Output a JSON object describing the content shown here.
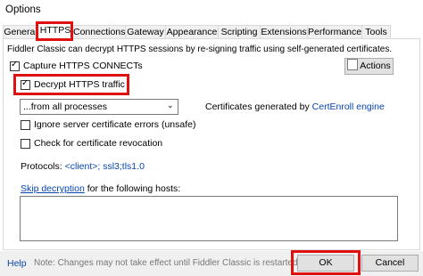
{
  "window": {
    "title": "Options"
  },
  "tabs": [
    {
      "label": "General"
    },
    {
      "label": "HTTPS"
    },
    {
      "label": "Connections"
    },
    {
      "label": "Gateway"
    },
    {
      "label": "Appearance"
    },
    {
      "label": "Scripting"
    },
    {
      "label": "Extensions"
    },
    {
      "label": "Performance"
    },
    {
      "label": "Tools"
    }
  ],
  "https": {
    "description": "Fiddler Classic can decrypt HTTPS sessions by re-signing traffic using self-generated certificates.",
    "actions_label": "Actions",
    "capture_label": "Capture HTTPS CONNECTs",
    "decrypt_label": "Decrypt HTTPS traffic",
    "process_select": "...from all processes",
    "cert_generated_text": "Certificates generated by ",
    "cert_engine_link": "CertEnroll engine",
    "ignore_errors_label": "Ignore server certificate errors (unsafe)",
    "revocation_label": "Check for certificate revocation",
    "protocols_label": "Protocols: ",
    "protocols_value": "<client>; ssl3;tls1.0",
    "skip_link": "Skip decryption",
    "skip_rest": " for the following hosts:"
  },
  "footer": {
    "help_link": "Help",
    "note": "Note: Changes may not take effect until Fiddler Classic is restarted.",
    "ok_label": "OK",
    "cancel_label": "Cancel"
  },
  "colors": {
    "highlight": "#e01010",
    "link": "#0645ad"
  }
}
